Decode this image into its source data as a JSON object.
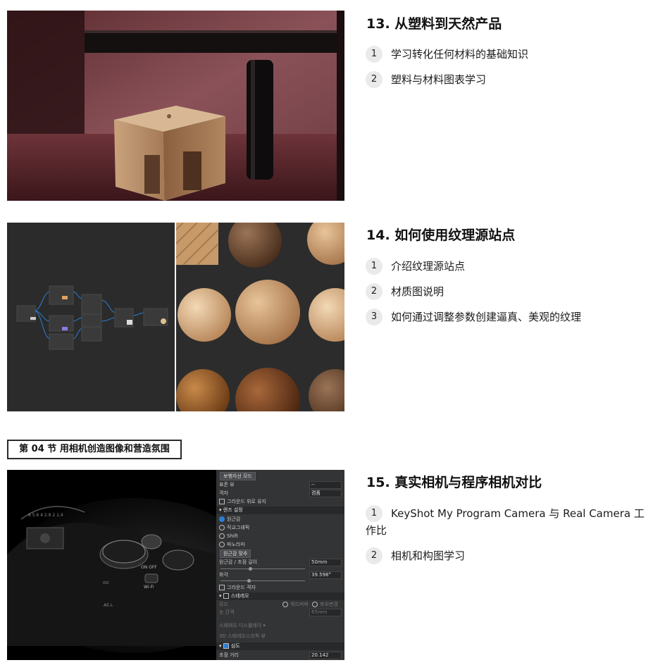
{
  "lessons": [
    {
      "title": "13. 从塑料到天然产品",
      "items": [
        {
          "num": "1",
          "text": "学习转化任何材料的基础知识"
        },
        {
          "num": "2",
          "text": "塑料与材料图表学习"
        }
      ]
    },
    {
      "title": "14. 如何使用纹理源站点",
      "items": [
        {
          "num": "1",
          "text": "介绍纹理源站点"
        },
        {
          "num": "2",
          "text": "材质图说明"
        },
        {
          "num": "3",
          "text": "如何通过调整参数创建逼真、美观的纹理"
        }
      ]
    },
    {
      "title": "15. 真实相机与程序相机对比",
      "items": [
        {
          "num": "1",
          "text": "KeyShot My Program Camera 与 Real Camera 工作比"
        },
        {
          "num": "2",
          "text": "相机和构图学习"
        }
      ]
    }
  ],
  "section_label": "第 04 节 用相机创造图像和营造氛围",
  "keyshot_panel": {
    "mode_button": "보행자선 모드",
    "standard_view": "표준 뷰",
    "standard_view_value": "--",
    "grid": "격자",
    "grid_value": "켬퓸",
    "ground_grid": "그라운드 위로 유지",
    "lens_settings": "렌즈 설정",
    "lens_options": [
      "원근감",
      "직교그래픽",
      "Shift",
      "파노라마"
    ],
    "perspective_match": "원근감 맞추",
    "focal_label": "원근감 / 초점 길이",
    "focal_value": "50mm",
    "fov_label": "화각",
    "fov_value": "39.598°",
    "ground_grid2": "그라운드 격자",
    "stereo": "스테레오",
    "stereo_mode": "모드",
    "stereo_opt1": "쿼드버퍼",
    "stereo_opt2": "좌우변경",
    "eye_distance": "눈 간격",
    "eye_value": "65mm",
    "stereo_display": "스테레오 디스플레이",
    "stereo_view": "3D 스테레오스코픽 뷰",
    "depth": "심도",
    "focus_distance": "초점 거리",
    "focus_value": "20.142"
  },
  "colors": {
    "number_badge": "#eaeaea",
    "panel_bg": "#333436"
  }
}
